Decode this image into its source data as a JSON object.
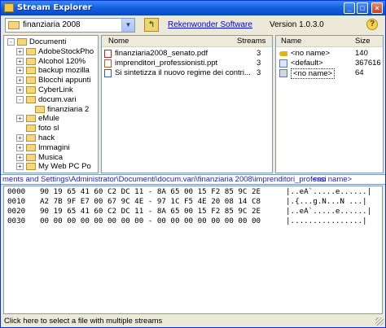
{
  "window": {
    "title": "Stream Explorer"
  },
  "toolbar": {
    "folder_value": "finanziaria 2008",
    "link_label": "Rekenwonder Software",
    "version": "Version 1.0.3.0"
  },
  "tree": [
    {
      "label": "Documenti",
      "level": 0,
      "expander": "-"
    },
    {
      "label": "AdobeStockPho",
      "level": 1,
      "expander": "+"
    },
    {
      "label": "Alcohol 120%",
      "level": 1,
      "expander": "+"
    },
    {
      "label": "backup mozilla",
      "level": 1,
      "expander": "+"
    },
    {
      "label": "Blocchi appunti",
      "level": 1,
      "expander": "+"
    },
    {
      "label": "CyberLink",
      "level": 1,
      "expander": "+"
    },
    {
      "label": "docum.vari",
      "level": 1,
      "expander": "-"
    },
    {
      "label": "finanziaria 2",
      "level": 2,
      "expander": ""
    },
    {
      "label": "eMule",
      "level": 1,
      "expander": "+"
    },
    {
      "label": "foto sl",
      "level": 1,
      "expander": ""
    },
    {
      "label": "hack",
      "level": 1,
      "expander": "+"
    },
    {
      "label": "Immagini",
      "level": 1,
      "expander": "+"
    },
    {
      "label": "Musica",
      "level": 1,
      "expander": "+"
    },
    {
      "label": "My Web PC Po",
      "level": 1,
      "expander": "+"
    }
  ],
  "files": {
    "col_name": "Nome",
    "col_streams": "Streams",
    "rows": [
      {
        "icon": "pdf-icon",
        "name": "finanziaria2008_senato.pdf",
        "streams": "3"
      },
      {
        "icon": "ppt-icon",
        "name": "imprenditori_professionisti.ppt",
        "streams": "3"
      },
      {
        "icon": "htm-icon",
        "name": "Si sintetizza il nuovo regime dei contri...",
        "streams": "3"
      }
    ]
  },
  "streams": {
    "col_name": "Name",
    "col_size": "Size",
    "rows": [
      {
        "icon": "key-icon",
        "name": "<no name>",
        "size": "140"
      },
      {
        "icon": "document-icon",
        "name": "<default>",
        "size": "367616"
      },
      {
        "icon": "link-icon",
        "name": "<no name>",
        "size": "64"
      }
    ]
  },
  "pathbar": {
    "path": "ments and Settings\\Administrator\\Documenti\\docum.vari\\finanziaria 2008\\imprenditori_professi",
    "stream": "<no name>"
  },
  "hex": [
    {
      "offset": "0000",
      "bytes": "90 19 65 41 60 C2 DC 11 - 8A 65 00 15 F2 85 9C 2E",
      "ascii": "|..eA`.....e......|"
    },
    {
      "offset": "0010",
      "bytes": "A2 7B 9F E7 00 67 9C 4E - 97 1C F5 4E 20 08 14 C8",
      "ascii": "|.{...g.N...N ...|"
    },
    {
      "offset": "0020",
      "bytes": "90 19 65 41 60 C2 DC 11 - 8A 65 00 15 F2 85 9C 2E",
      "ascii": "|..eA`.....e......|"
    },
    {
      "offset": "0030",
      "bytes": "00 00 00 00 00 00 00 00 - 00 00 00 00 00 00 00 00",
      "ascii": "|................|"
    }
  ],
  "status": {
    "text": "Click here to select a file with multiple streams"
  }
}
